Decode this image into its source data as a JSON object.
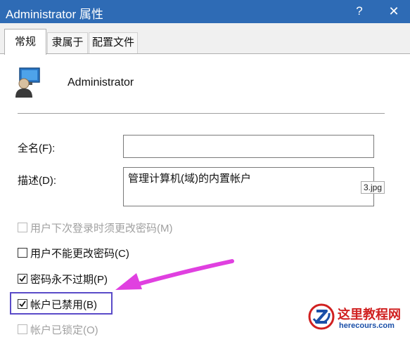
{
  "window": {
    "title": "Administrator 属性",
    "help_label": "?",
    "close_label": "✕"
  },
  "tabs": [
    {
      "label": "常规",
      "active": true
    },
    {
      "label": "隶属于",
      "active": false
    },
    {
      "label": "配置文件",
      "active": false
    }
  ],
  "user": {
    "name": "Administrator",
    "icon": "user-account-icon"
  },
  "fields": {
    "fullname_label": "全名(F):",
    "fullname_value": "",
    "description_label": "描述(D):",
    "description_value": "管理计算机(域)的内置帐户"
  },
  "tooltip": "3.jpg",
  "checkboxes": [
    {
      "label": "用户下次登录时须更改密码(M)",
      "checked": false,
      "disabled": true
    },
    {
      "label": "用户不能更改密码(C)",
      "checked": false,
      "disabled": false
    },
    {
      "label": "密码永不过期(P)",
      "checked": true,
      "disabled": false
    },
    {
      "label": "帐户已禁用(B)",
      "checked": true,
      "disabled": false
    },
    {
      "label": "帐户已锁定(O)",
      "checked": false,
      "disabled": true
    }
  ],
  "annotation": {
    "highlight_color": "#5a4bc8",
    "arrow_color": "#e040e0"
  },
  "watermark": {
    "title": "这里教程网",
    "url": "herecours.com"
  },
  "colors": {
    "titlebar": "#2e6bb5",
    "watermark_red": "#d02020",
    "watermark_blue": "#1a4fa8"
  }
}
